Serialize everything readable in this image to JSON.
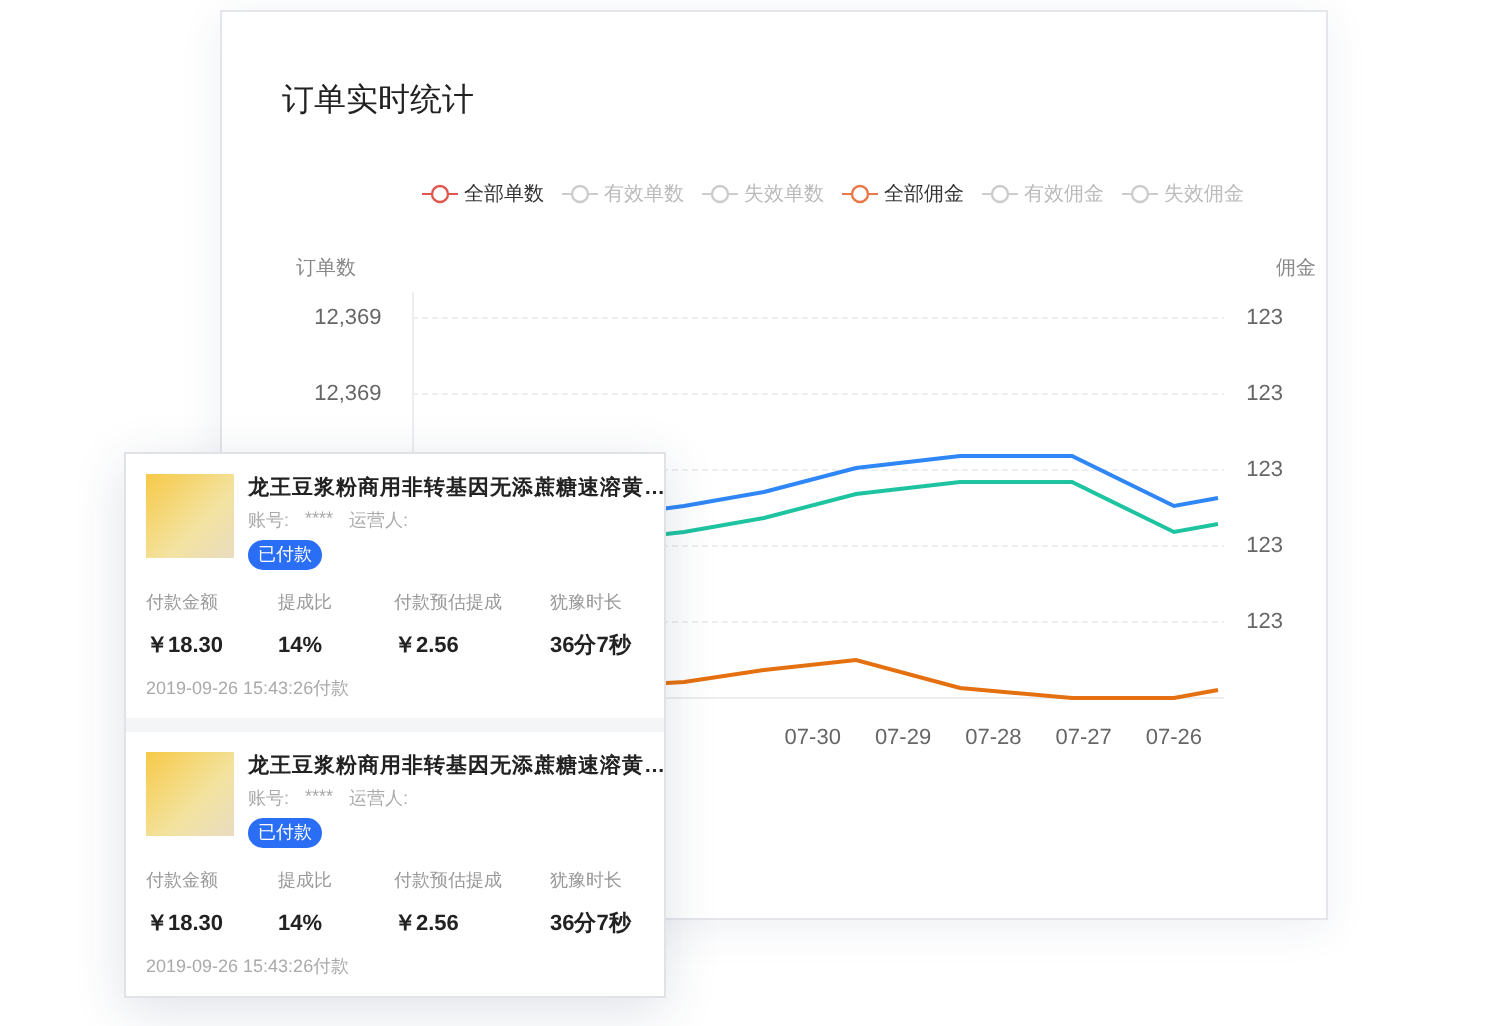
{
  "title": "订单实时统计",
  "legend": [
    {
      "label": "全部单数",
      "selected": true,
      "color": "#e0574f"
    },
    {
      "label": "有效单数",
      "selected": false,
      "color": "#cccccc"
    },
    {
      "label": "失效单数",
      "selected": false,
      "color": "#cccccc"
    },
    {
      "label": "全部佣金",
      "selected": true,
      "color": "#e8784a"
    },
    {
      "label": "有效佣金",
      "selected": false,
      "color": "#cccccc"
    },
    {
      "label": "失效佣金",
      "selected": false,
      "color": "#cccccc"
    }
  ],
  "chart": {
    "left_axis_title": "订单数",
    "right_axis_title": "佣金",
    "left_ticks": [
      "12,369",
      "12,369"
    ],
    "right_ticks": [
      "123",
      "123",
      "123",
      "123",
      "123"
    ],
    "x_labels": [
      "07-30",
      "07-29",
      "07-28",
      "07-27",
      "07-26"
    ]
  },
  "orders": [
    {
      "title": "龙王豆浆粉商用非转基因无添蔗糖速溶黄…",
      "account_label": "账号:",
      "account": "****",
      "operator_label": "运营人:",
      "status": "已付款",
      "stats": [
        {
          "label": "付款金额",
          "value": "￥18.30"
        },
        {
          "label": "提成比",
          "value": "14%"
        },
        {
          "label": "付款预估提成",
          "value": "￥2.56"
        },
        {
          "label": "犹豫时长",
          "value": "36分7秒"
        }
      ],
      "time": "2019-09-26 15:43:26付款"
    },
    {
      "title": "龙王豆浆粉商用非转基因无添蔗糖速溶黄…",
      "account_label": "账号:",
      "account": "****",
      "operator_label": "运营人:",
      "status": "已付款",
      "stats": [
        {
          "label": "付款金额",
          "value": "￥18.30"
        },
        {
          "label": "提成比",
          "value": "14%"
        },
        {
          "label": "付款预估提成",
          "value": "￥2.56"
        },
        {
          "label": "犹豫时长",
          "value": "36分7秒"
        }
      ],
      "time": "2019-09-26 15:43:26付款"
    }
  ]
}
